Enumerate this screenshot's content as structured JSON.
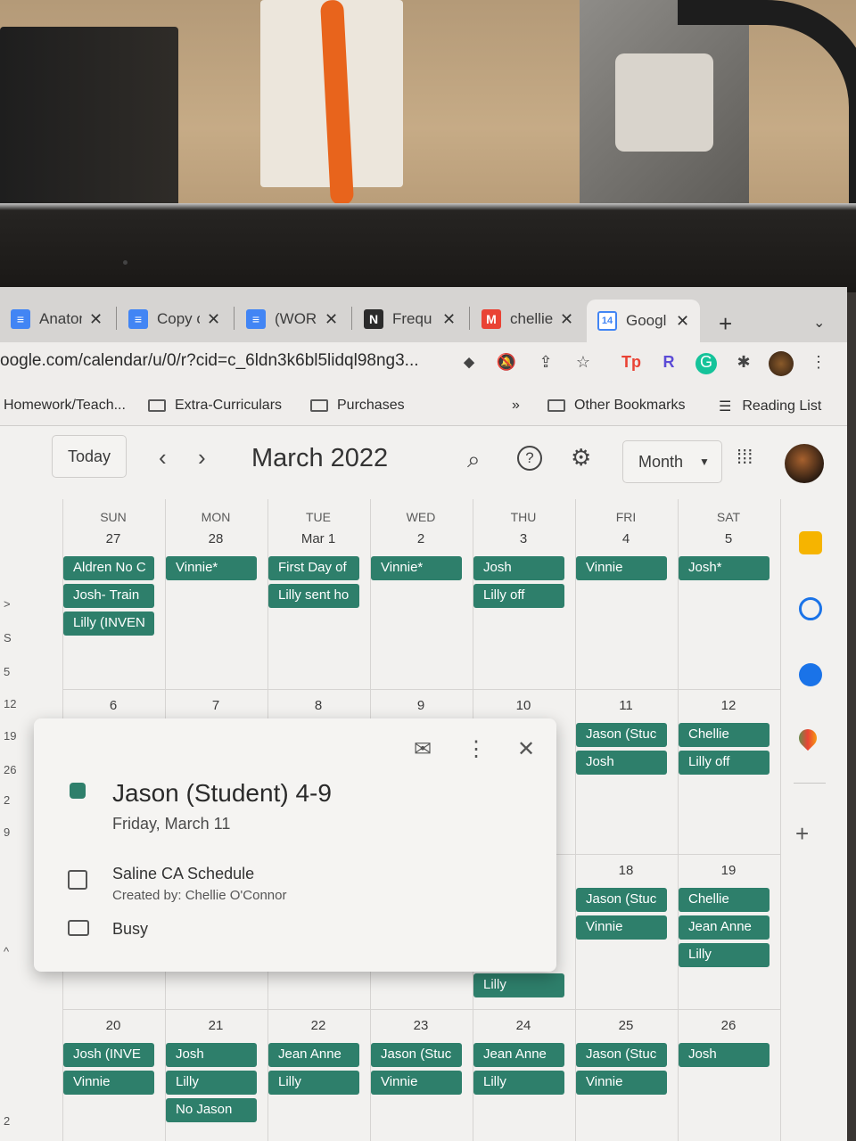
{
  "tabs": [
    {
      "label": "Anatom",
      "icon": "docs-icon",
      "color": "#4285f4"
    },
    {
      "label": "Copy o",
      "icon": "docs-icon",
      "color": "#4285f4"
    },
    {
      "label": "(WOR",
      "icon": "docs-icon",
      "color": "#4285f4"
    },
    {
      "label": "Frequ",
      "icon": "notion-icon",
      "color": "#2b2b2b"
    },
    {
      "label": "chellie",
      "icon": "gmail-icon",
      "color": "#e94335"
    },
    {
      "label": "Googl",
      "icon": "google-calendar-icon",
      "color": "#4285f4",
      "icon_text": "14"
    }
  ],
  "address": {
    "url": "oogle.com/calendar/u/0/r?cid=c_6ldn3k6bl5lidql98ng3..."
  },
  "bookmarks": {
    "items": [
      "Homework/Teach...",
      "Extra-Curriculars",
      "Purchases"
    ],
    "overflow": "»",
    "other": "Other Bookmarks",
    "reading_list": "Reading List"
  },
  "calendar": {
    "today_label": "Today",
    "month_title": "March 2022",
    "view_label": "Month",
    "weekdays": [
      "SUN",
      "MON",
      "TUE",
      "WED",
      "THU",
      "FRI",
      "SAT"
    ],
    "weeks": [
      {
        "days": [
          {
            "num": "27",
            "events": [
              "Aldren No C",
              "Josh- Train",
              "Lilly (INVEN"
            ]
          },
          {
            "num": "28",
            "events": [
              "Vinnie*"
            ]
          },
          {
            "num": "Mar 1",
            "events": [
              "First Day of",
              "Lilly sent ho"
            ]
          },
          {
            "num": "2",
            "events": [
              "Vinnie*"
            ]
          },
          {
            "num": "3",
            "events": [
              "Josh",
              "Lilly off"
            ]
          },
          {
            "num": "4",
            "events": [
              "Vinnie"
            ]
          },
          {
            "num": "5",
            "events": [
              "Josh*"
            ]
          }
        ]
      },
      {
        "days": [
          {
            "num": "6",
            "events": []
          },
          {
            "num": "7",
            "events": []
          },
          {
            "num": "8",
            "events": []
          },
          {
            "num": "9",
            "events": []
          },
          {
            "num": "10",
            "events": []
          },
          {
            "num": "11",
            "events": [
              "Jason (Stuc",
              "Josh"
            ]
          },
          {
            "num": "12",
            "events": [
              "Chellie",
              "Lilly off"
            ]
          }
        ]
      },
      {
        "days": [
          {
            "num": "",
            "events": []
          },
          {
            "num": "",
            "events": []
          },
          {
            "num": "",
            "events": []
          },
          {
            "num": "",
            "events": []
          },
          {
            "num": "",
            "events": [
              "Lilly"
            ]
          },
          {
            "num": "18",
            "events": [
              "Jason (Stuc",
              "Vinnie"
            ]
          },
          {
            "num": "19",
            "events": [
              "Chellie",
              "Jean Anne",
              "Lilly"
            ]
          }
        ]
      },
      {
        "days": [
          {
            "num": "20",
            "events": [
              "Josh (INVE",
              "Vinnie"
            ]
          },
          {
            "num": "21",
            "events": [
              "Josh",
              "Lilly",
              "No Jason"
            ]
          },
          {
            "num": "22",
            "events": [
              "Jean Anne",
              "Lilly"
            ]
          },
          {
            "num": "23",
            "events": [
              "Jason (Stuc",
              "Vinnie"
            ]
          },
          {
            "num": "24",
            "events": [
              "Jean Anne",
              "Lilly"
            ]
          },
          {
            "num": "25",
            "events": [
              "Jason (Stuc",
              "Vinnie"
            ]
          },
          {
            "num": "26",
            "events": [
              "Josh"
            ]
          }
        ]
      }
    ],
    "mini_left": [
      ">",
      "S",
      "5",
      "12",
      "19",
      "26",
      "2",
      "9",
      "^",
      "2"
    ],
    "event_color": "#2e7f6b"
  },
  "popup": {
    "title": "Jason (Student) 4-9",
    "date": "Friday, March 11",
    "calendar_name": "Saline CA Schedule",
    "created_by": "Created by: Chellie O'Connor",
    "availability": "Busy"
  }
}
